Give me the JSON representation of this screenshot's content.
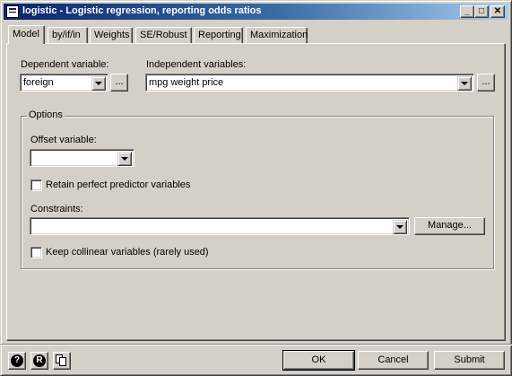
{
  "window": {
    "title": "logistic - Logistic regression, reporting odds ratios",
    "controls": {
      "minimize": "_",
      "maximize": "□",
      "close": "✕"
    }
  },
  "tabs": [
    {
      "label": "Model",
      "active": true
    },
    {
      "label": "by/if/in",
      "active": false
    },
    {
      "label": "Weights",
      "active": false
    },
    {
      "label": "SE/Robust",
      "active": false
    },
    {
      "label": "Reporting",
      "active": false
    },
    {
      "label": "Maximization",
      "active": false
    }
  ],
  "model": {
    "dependent_label": "Dependent variable:",
    "dependent_value": "foreign",
    "independent_label": "Independent variables:",
    "independent_value": "mpg weight price",
    "browse_label": "...",
    "options_legend": "Options",
    "offset_label": "Offset variable:",
    "offset_value": "",
    "retain_label": "Retain perfect predictor variables",
    "retain_checked": false,
    "constraints_label": "Constraints:",
    "constraints_value": "",
    "manage_label": "Manage...",
    "collinear_label": "Keep collinear variables (rarely used)",
    "collinear_checked": false
  },
  "footer": {
    "help_icon": "help-icon",
    "reset_icon": "reset-icon",
    "copy_icon": "copy-command-icon",
    "ok_label": "OK",
    "cancel_label": "Cancel",
    "submit_label": "Submit"
  },
  "colors": {
    "face": "#d4d0c8",
    "title_start": "#0a246a",
    "title_end": "#a6caf0"
  }
}
